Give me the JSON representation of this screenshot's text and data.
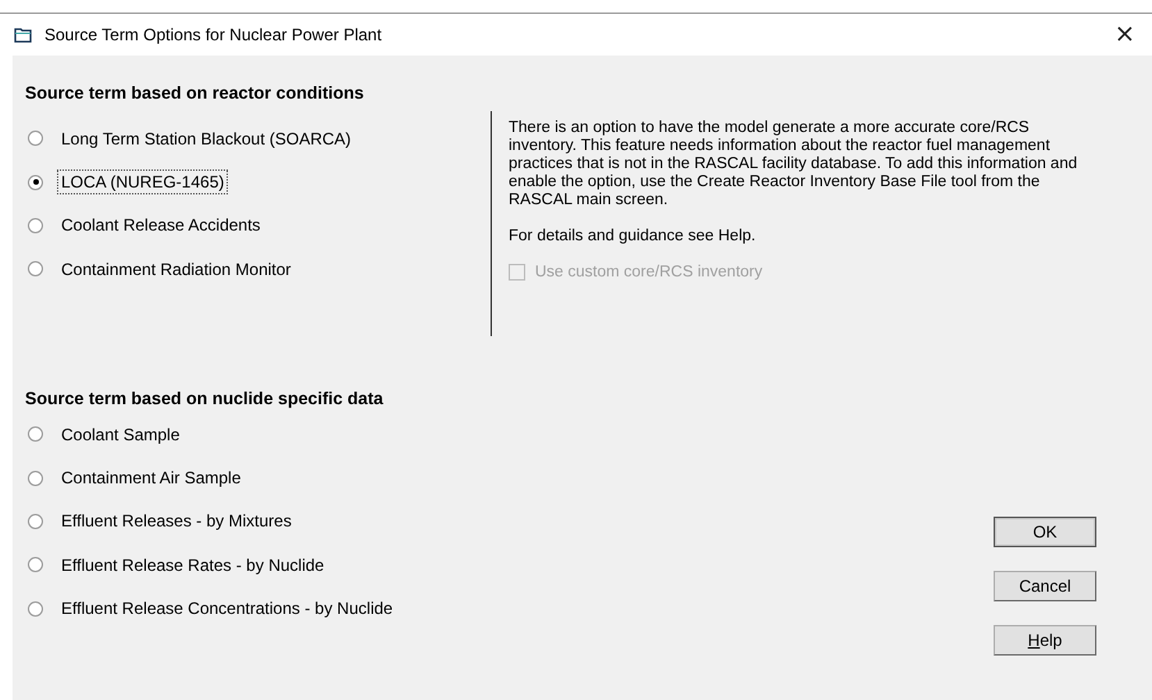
{
  "window": {
    "title": "Source Term Options for Nuclear Power Plant",
    "close": "×"
  },
  "reactor_section": {
    "heading": "Source term based on reactor conditions",
    "options": [
      {
        "label": "Long Term Station Blackout (SOARCA)",
        "selected": false,
        "focused": false
      },
      {
        "label": "LOCA (NUREG-1465)",
        "selected": true,
        "focused": true
      },
      {
        "label": "Coolant Release Accidents",
        "selected": false,
        "focused": false
      },
      {
        "label": "Containment Radiation Monitor",
        "selected": false,
        "focused": false
      }
    ],
    "info": [
      "There is an option to have the model generate a more accurate core/RCS inventory. This feature needs information about the reactor fuel management practices that is not in the RASCAL facility database. To add this information and enable the option, use the Create Reactor Inventory Base File tool from the RASCAL main screen.",
      "For details and guidance see Help."
    ],
    "custom_inventory": {
      "label": "Use custom core/RCS inventory",
      "checked": false,
      "disabled": true
    }
  },
  "nuclide_section": {
    "heading": "Source term based on nuclide specific data",
    "options": [
      {
        "label": "Coolant Sample",
        "selected": false,
        "focused": false
      },
      {
        "label": "Containment Air Sample",
        "selected": false,
        "focused": false
      },
      {
        "label": "Effluent Releases - by Mixtures",
        "selected": false,
        "focused": false
      },
      {
        "label": "Effluent Release Rates - by Nuclide",
        "selected": false,
        "focused": false
      },
      {
        "label": "Effluent Release Concentrations - by Nuclide",
        "selected": false,
        "focused": false
      }
    ]
  },
  "buttons": [
    {
      "label": "OK",
      "default": true,
      "mnemonic": false
    },
    {
      "label": "Cancel",
      "default": false,
      "mnemonic": false
    },
    {
      "label": "Help",
      "default": false,
      "mnemonic": true
    }
  ]
}
